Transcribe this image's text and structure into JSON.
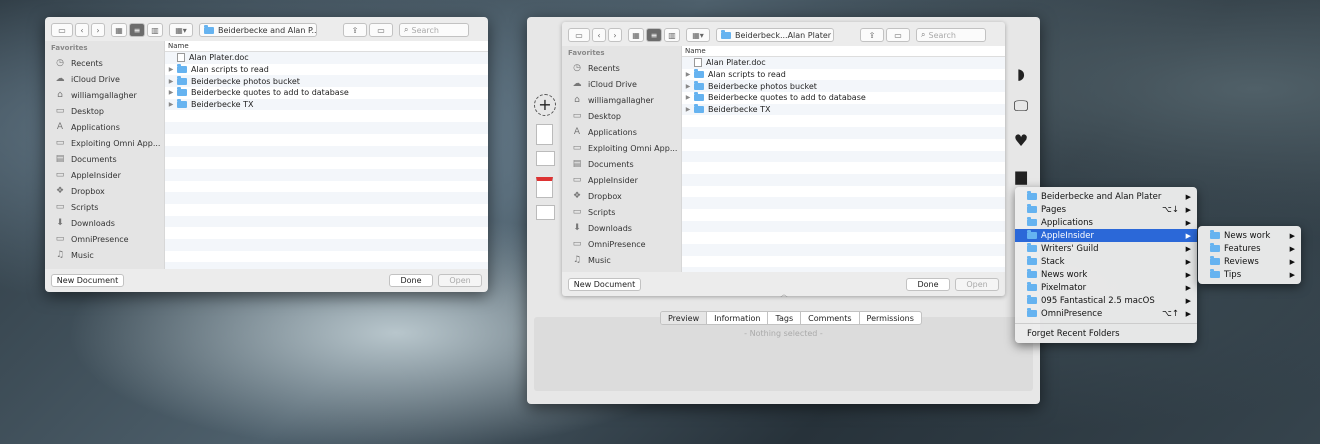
{
  "left": {
    "location": "Beiderbecke and Alan P...",
    "search_placeholder": "Search",
    "favorites_label": "Favorites",
    "sidebar": [
      "Recents",
      "iCloud Drive",
      "williamgallagher",
      "Desktop",
      "Applications",
      "Exploiting Omni App...",
      "Documents",
      "AppleInsider",
      "Dropbox",
      "Scripts",
      "Downloads",
      "OmniPresence",
      "Music"
    ],
    "column_name": "Name",
    "files": [
      {
        "name": "Alan Plater.doc",
        "kind": "doc"
      },
      {
        "name": "Alan scripts to read",
        "kind": "folder"
      },
      {
        "name": "Beiderbecke photos bucket",
        "kind": "folder"
      },
      {
        "name": "Beiderbecke quotes to add to database",
        "kind": "folder"
      },
      {
        "name": "Beiderbecke TX",
        "kind": "folder"
      }
    ],
    "new_doc": "New Document",
    "done": "Done",
    "open": "Open"
  },
  "right": {
    "location": "Beiderbeck...Alan Plater",
    "search_placeholder": "Search",
    "favorites_label": "Favorites",
    "sidebar": [
      "Recents",
      "iCloud Drive",
      "williamgallagher",
      "Desktop",
      "Applications",
      "Exploiting Omni App...",
      "Documents",
      "AppleInsider",
      "Dropbox",
      "Scripts",
      "Downloads",
      "OmniPresence",
      "Music"
    ],
    "column_name": "Name",
    "files": [
      {
        "name": "Alan Plater.doc",
        "kind": "doc"
      },
      {
        "name": "Alan scripts to read",
        "kind": "folder"
      },
      {
        "name": "Beiderbecke photos bucket",
        "kind": "folder"
      },
      {
        "name": "Beiderbecke quotes to add to database",
        "kind": "folder"
      },
      {
        "name": "Beiderbecke TX",
        "kind": "folder"
      }
    ],
    "new_doc": "New Document",
    "done": "Done",
    "open": "Open",
    "tabs": [
      "Preview",
      "Information",
      "Tags",
      "Comments",
      "Permissions"
    ],
    "nothing_selected": "- Nothing selected -"
  },
  "menu": {
    "items": [
      {
        "label": "Beiderbecke and Alan Plater",
        "shortcut": ""
      },
      {
        "label": "Pages",
        "shortcut": "⌥↓"
      },
      {
        "label": "Applications",
        "shortcut": ""
      },
      {
        "label": "AppleInsider",
        "shortcut": "",
        "highlight": true
      },
      {
        "label": "Writers' Guild",
        "shortcut": ""
      },
      {
        "label": "Stack",
        "shortcut": ""
      },
      {
        "label": "News work",
        "shortcut": ""
      },
      {
        "label": "Pixelmator",
        "shortcut": ""
      },
      {
        "label": "095 Fantastical 2.5 macOS",
        "shortcut": ""
      },
      {
        "label": "OmniPresence",
        "shortcut": "⌥↑"
      }
    ],
    "forget": "Forget Recent Folders"
  },
  "submenu": [
    "News work",
    "Features",
    "Reviews",
    "Tips"
  ],
  "sidebar_icons": [
    "clock-icon",
    "cloud-icon",
    "home-icon",
    "desktop-icon",
    "applications-icon",
    "folder-icon",
    "documents-icon",
    "folder-icon",
    "dropbox-icon",
    "folder-icon",
    "downloads-icon",
    "folder-icon",
    "music-icon"
  ],
  "accent_color": "#2b68d8",
  "folder_color": "#66b3f0"
}
